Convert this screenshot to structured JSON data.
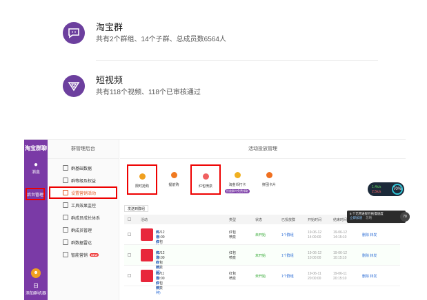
{
  "cards": [
    {
      "icon": "chat-bubble-icon",
      "title": "淘宝群",
      "desc": "共有2个群组、14个子群、总成员数6564人"
    },
    {
      "icon": "video-triangle-icon",
      "title": "短视频",
      "desc": "共有118个视频、118个已审核通过"
    }
  ],
  "rail": {
    "logo": "淘宝群聊",
    "message": "消息",
    "admin": "后台管理",
    "add_bot": "添加群机器"
  },
  "menu": {
    "header": "群管理后台",
    "items": [
      {
        "label": "群基础数据",
        "active": false
      },
      {
        "label": "群等级及权益",
        "active": false
      },
      {
        "label": "设置营销活动",
        "active": true
      },
      {
        "label": "工具效果监控",
        "active": false
      },
      {
        "label": "群成员成长体系",
        "active": false
      },
      {
        "label": "群成员管理",
        "active": false
      },
      {
        "label": "群数据雷达",
        "active": false
      },
      {
        "label": "智能营销",
        "active": false,
        "badge": "NEW"
      }
    ]
  },
  "main": {
    "title": "活动投放管理",
    "types": [
      {
        "label": "限时抢购",
        "color": "#f0a020",
        "highlight": true
      },
      {
        "label": "提前购",
        "color": "#f07a20",
        "highlight": false
      },
      {
        "label": "红包喷泉",
        "color": "#f06060",
        "highlight": true
      },
      {
        "label": "淘金币打卡",
        "color": "#f0b020",
        "highlight": false,
        "tag": "投放群内免费领取"
      },
      {
        "label": "拼团卡片",
        "color": "#f07020",
        "highlight": false
      }
    ],
    "send_button": "发送到群组",
    "columns": [
      "活动",
      "类型",
      "状态",
      "已投放群",
      "开始时间",
      "结束时间",
      "操作"
    ],
    "rows": [
      {
        "name": "06/12 14:00红包喷泉",
        "sub1": "红包(1种)",
        "sub2": "优惠券(1种)",
        "type": "红包喷泉",
        "status": "未开始",
        "groups": "1个群组",
        "start": "19-06-12 14:00:00",
        "end": "19-06-12 14:15:10",
        "ops": "删除 转发"
      },
      {
        "name": "06/12 10:00红包喷泉",
        "sub1": "红包(1种)",
        "sub2": "优惠券(1种)",
        "type": "红包喷泉",
        "status": "未开始",
        "groups": "1个群组",
        "start": "19-06-12 10:00:00",
        "end": "19-06-12 10:15:10",
        "ops": "删除 转发"
      },
      {
        "name": "06/11 20:00红包喷泉",
        "sub1": "红包(1种)",
        "sub2": "优惠券(1种)",
        "type": "红包喷泉",
        "status": "未开始",
        "groups": "1个群组",
        "start": "19-06-11 20:00:00",
        "end": "19-06-11 20:15:10",
        "ops": "删除 转发"
      }
    ]
  },
  "floating": {
    "net_up": "1.4k/s",
    "net_down": "2.5k/s",
    "percent": "70%",
    "tip": "5 个无用进程在拖慢速度",
    "tip_link": "立即加速",
    "tip_close": "忽略"
  }
}
